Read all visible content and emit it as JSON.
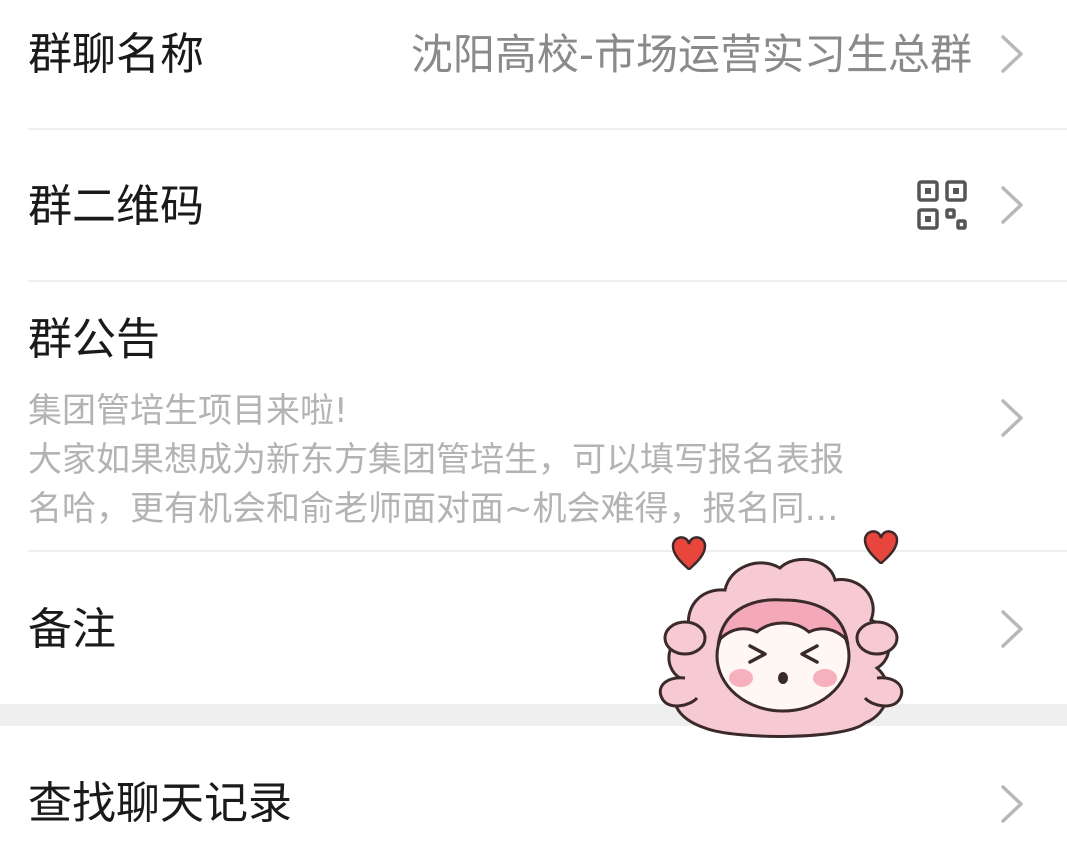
{
  "group_name": {
    "label": "群聊名称",
    "value": "沈阳高校-市场运营实习生总群"
  },
  "qr_code": {
    "label": "群二维码"
  },
  "announcement": {
    "label": "群公告",
    "lines": [
      "集团管培生项目来啦!",
      "大家如果想成为新东方集团管培生，可以填写报名表报",
      "名哈，更有机会和俞老师面对面~机会难得，报名同…"
    ]
  },
  "remark": {
    "label": "备注"
  },
  "search_history": {
    "label": "查找聊天记录"
  },
  "icons": {
    "chevron": "chevron-right-icon",
    "qr": "qr-code-icon",
    "sticker": "sheep-sticker-icon"
  },
  "colors": {
    "text_primary": "#1a1a1a",
    "text_secondary": "#8a8a8a",
    "text_tertiary": "#b3b3b3",
    "divider": "#eeeeee",
    "section_gap": "#efefef",
    "sticker_pink": "#f6c9d3",
    "heart_red": "#e8453c"
  }
}
